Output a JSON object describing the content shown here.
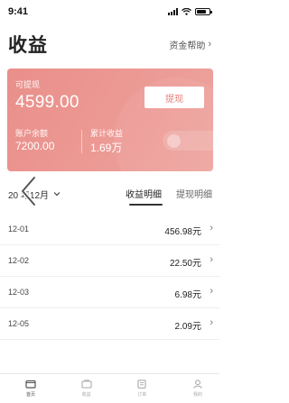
{
  "status_bar": {
    "time": "9:41"
  },
  "header": {
    "title": "收益",
    "help_label": "资金帮助",
    "help_chevron": "›"
  },
  "card": {
    "withdrawable_label": "可提现",
    "withdrawable_amount": "4599.00",
    "withdraw_button": "提现",
    "balance_label": "账户余额",
    "balance_value": "7200.00",
    "total_label": "累计收益",
    "total_value": "1.69万"
  },
  "filter": {
    "month": "20  年12月",
    "tabs": [
      {
        "label": "收益明细",
        "active": true
      },
      {
        "label": "提现明细",
        "active": false
      }
    ]
  },
  "list": [
    {
      "date": "12-01",
      "amount": "456.98元"
    },
    {
      "date": "12-02",
      "amount": "22.50元"
    },
    {
      "date": "12-03",
      "amount": "6.98元"
    },
    {
      "date": "12-05",
      "amount": "2.09元"
    }
  ],
  "tab_bar": [
    {
      "label": "首页",
      "icon": "home-icon",
      "active": true
    },
    {
      "label": "收益",
      "icon": "wallet-icon",
      "active": false
    },
    {
      "label": "订单",
      "icon": "order-icon",
      "active": false
    },
    {
      "label": "我的",
      "icon": "profile-icon",
      "active": false
    }
  ],
  "colors": {
    "card_start": "#ea8f8a",
    "card_end": "#eea5a0",
    "withdraw_text": "#e57f78"
  }
}
